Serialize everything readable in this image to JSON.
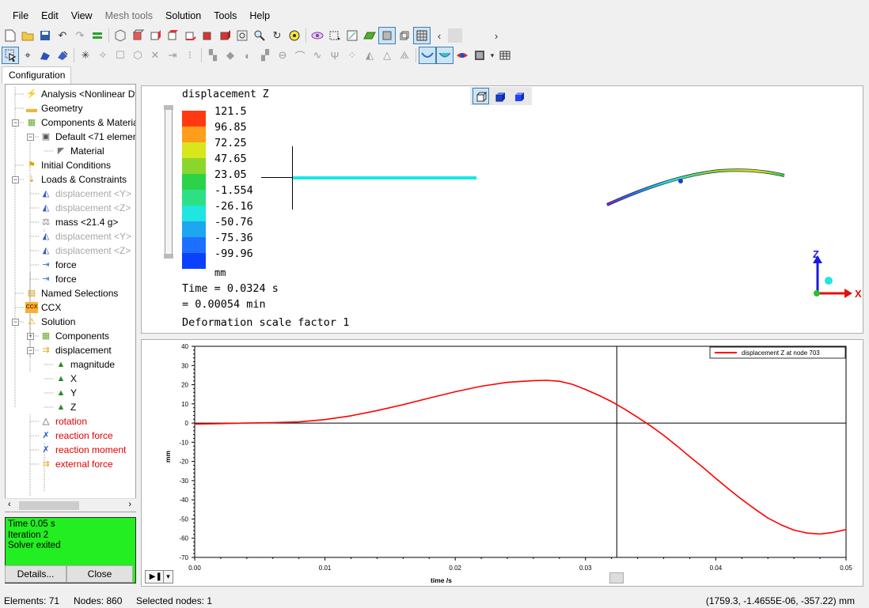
{
  "menu": [
    "File",
    "Edit",
    "View",
    "Mesh tools",
    "Solution",
    "Tools",
    "Help"
  ],
  "tab": "Configuration",
  "tree": [
    {
      "label": "Analysis <Nonlinear Dy",
      "indent": 0,
      "icon": "analysis-icon",
      "color": "normal"
    },
    {
      "label": "Geometry",
      "indent": 0,
      "icon": "folder-icon",
      "color": "normal"
    },
    {
      "label": "Components & Materia",
      "indent": 0,
      "icon": "components-icon",
      "color": "normal"
    },
    {
      "label": "Default <71 elemen",
      "indent": 1,
      "icon": "group-icon",
      "color": "normal"
    },
    {
      "label": "Material",
      "indent": 2,
      "icon": "material-icon",
      "color": "normal"
    },
    {
      "label": "Initial Conditions",
      "indent": 0,
      "icon": "initial-conditions-icon",
      "color": "normal"
    },
    {
      "label": "Loads & Constraints",
      "indent": 0,
      "icon": "loads-icon",
      "color": "normal"
    },
    {
      "label": "displacement <Y>",
      "indent": 1,
      "icon": "displacement-constraint-icon",
      "color": "grey"
    },
    {
      "label": "displacement <Z>",
      "indent": 1,
      "icon": "displacement-constraint-icon",
      "color": "grey"
    },
    {
      "label": "mass <21.4 g>",
      "indent": 1,
      "icon": "mass-icon",
      "color": "normal"
    },
    {
      "label": "displacement <Y>",
      "indent": 1,
      "icon": "displacement-constraint-icon",
      "color": "grey"
    },
    {
      "label": "displacement <Z>",
      "indent": 1,
      "icon": "displacement-constraint-icon",
      "color": "grey"
    },
    {
      "label": "force",
      "indent": 1,
      "icon": "force-icon",
      "color": "normal"
    },
    {
      "label": "force",
      "indent": 1,
      "icon": "force-icon",
      "color": "normal"
    },
    {
      "label": "Named Selections",
      "indent": 0,
      "icon": "named-selections-icon",
      "color": "normal"
    },
    {
      "label": "CCX",
      "indent": 0,
      "icon": "ccx-icon",
      "color": "normal"
    },
    {
      "label": "Solution",
      "indent": 0,
      "icon": "solution-icon",
      "color": "normal"
    },
    {
      "label": "Components",
      "indent": 1,
      "icon": "components-icon",
      "color": "normal"
    },
    {
      "label": "displacement",
      "indent": 1,
      "icon": "displacement-result-icon",
      "color": "normal"
    },
    {
      "label": "magnitude",
      "indent": 2,
      "icon": "result-triangle-icon",
      "color": "normal"
    },
    {
      "label": "X",
      "indent": 2,
      "icon": "result-triangle-icon",
      "color": "normal"
    },
    {
      "label": "Y",
      "indent": 2,
      "icon": "result-triangle-icon",
      "color": "normal"
    },
    {
      "label": "Z",
      "indent": 2,
      "icon": "result-triangle-icon",
      "color": "normal"
    },
    {
      "label": "rotation",
      "indent": 1,
      "icon": "result-triangle-empty-icon",
      "color": "red"
    },
    {
      "label": "reaction force",
      "indent": 1,
      "icon": "reaction-force-icon",
      "color": "red"
    },
    {
      "label": "reaction moment",
      "indent": 1,
      "icon": "reaction-moment-icon",
      "color": "red"
    },
    {
      "label": "external force",
      "indent": 1,
      "icon": "external-force-icon",
      "color": "red"
    }
  ],
  "solver": {
    "time": "Time 0.05 s",
    "iteration": "Iteration 2",
    "state": "Solver exited",
    "details_label": "Details...",
    "close_label": "Close",
    "color": "#22ee22"
  },
  "viewport": {
    "legend_title": "displacement Z",
    "legend_values": [
      "121.5",
      "96.85",
      "72.25",
      "47.65",
      "23.05",
      "-1.554",
      "-26.16",
      "-50.76",
      "-75.36",
      "-99.96"
    ],
    "legend_colors": [
      "#ff3a12",
      "#ff9d1c",
      "#d8e61c",
      "#8bd62c",
      "#2bd24a",
      "#2de084",
      "#21e5e0",
      "#1fa6f0",
      "#1d70ff",
      "#0c40ff"
    ],
    "unit": "mm",
    "time_line1": "Time = 0.0324 s",
    "time_line2": "= 0.00054 min",
    "scale_line": "Deformation scale factor 1",
    "axis_z": "Z",
    "axis_x": "X"
  },
  "chart_data": {
    "type": "line",
    "title": "",
    "xlabel": "time /s",
    "ylabel": "mm",
    "xlim": [
      0,
      0.05
    ],
    "ylim": [
      -70,
      40
    ],
    "xticks": [
      "0.00",
      "0.01",
      "0.02",
      "0.03",
      "0.04",
      "0.05"
    ],
    "yticks": [
      "40",
      "30",
      "20",
      "10",
      "0",
      "-10",
      "-20",
      "-30",
      "-40",
      "-50",
      "-60",
      "-70"
    ],
    "cursor_x": 0.0324,
    "legend_position": "top-right",
    "series": [
      {
        "name": "displacement Z at node 703",
        "color": "#ff0000",
        "x": [
          0,
          0.002,
          0.004,
          0.006,
          0.008,
          0.01,
          0.012,
          0.014,
          0.016,
          0.018,
          0.02,
          0.022,
          0.024,
          0.026,
          0.027,
          0.028,
          0.029,
          0.03,
          0.031,
          0.032,
          0.033,
          0.034,
          0.035,
          0.036,
          0.037,
          0.038,
          0.039,
          0.04,
          0.041,
          0.042,
          0.043,
          0.044,
          0.045,
          0.046,
          0.047,
          0.048,
          0.049,
          0.05
        ],
        "y": [
          -0.5,
          -0.3,
          0,
          0.2,
          0.6,
          1.8,
          3.8,
          6.5,
          9.6,
          13,
          16.3,
          19.2,
          21.2,
          22.1,
          22.3,
          21.8,
          20.2,
          17.5,
          14.5,
          11.2,
          7.3,
          3,
          -1.5,
          -6.4,
          -11.8,
          -17.5,
          -23,
          -28.8,
          -34.5,
          -39.8,
          -44.8,
          -49.5,
          -53,
          -55.8,
          -57.3,
          -57.8,
          -57,
          -55.5
        ]
      }
    ]
  },
  "statusbar": {
    "elements": "Elements: 71",
    "nodes": "Nodes: 860",
    "selected": "Selected nodes: 1",
    "coords": "(1759.3, -1.4655E-06, -357.22) mm"
  }
}
